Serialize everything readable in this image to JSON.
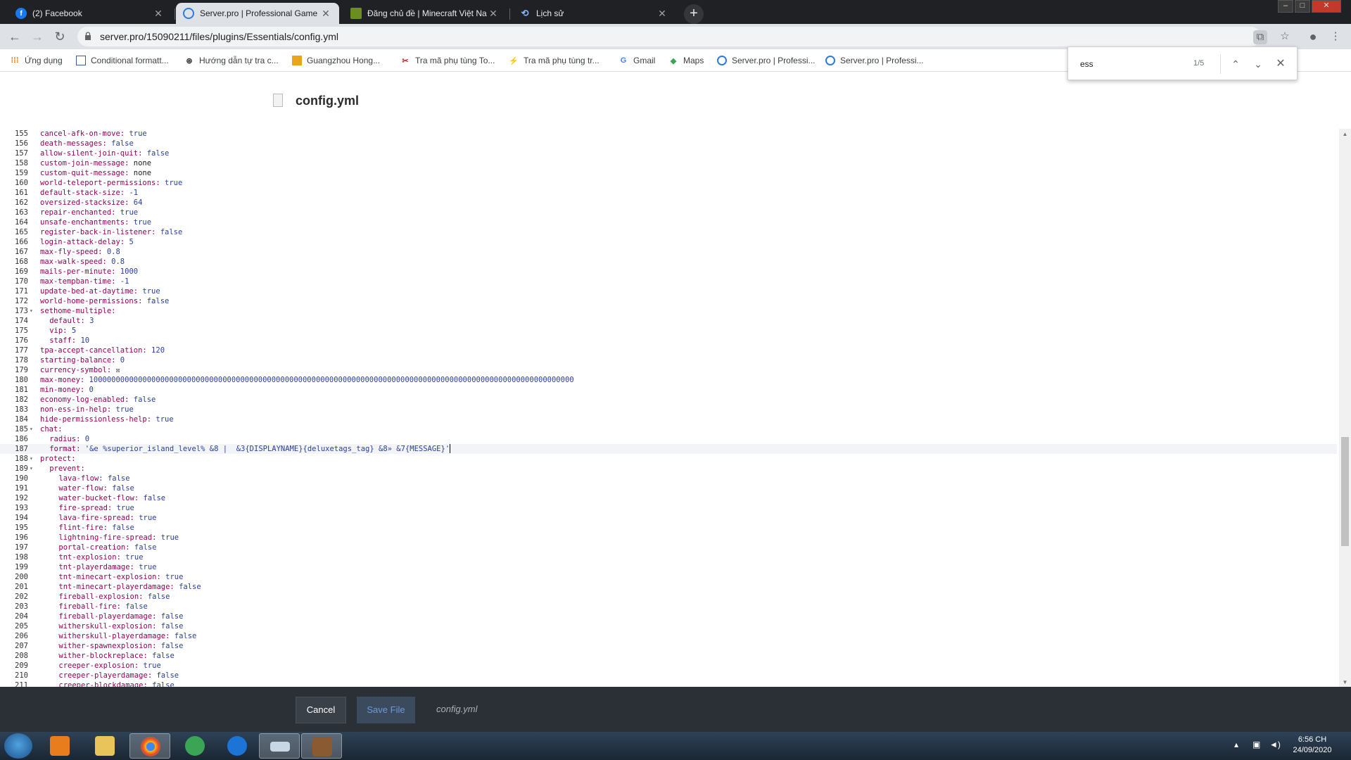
{
  "browser": {
    "tabs": [
      {
        "title": "(2) Facebook",
        "icon": "facebook-icon",
        "active": false
      },
      {
        "title": "Server.pro | Professional Game S",
        "icon": "serverpro-icon",
        "active": true
      },
      {
        "title": "Đăng chủ đề | Minecraft Việt Nan",
        "icon": "minecraft-icon",
        "active": false
      },
      {
        "title": "Lịch sử",
        "icon": "history-icon",
        "active": false
      }
    ],
    "url": "server.pro/15090211/files/plugins/Essentials/config.yml",
    "bookmarks": [
      {
        "label": "Ứng dụng",
        "icon": "apps-grid-icon"
      },
      {
        "label": "Conditional formatt...",
        "icon": "bookmark-doc-icon"
      },
      {
        "label": "Hướng dẫn tự tra c...",
        "icon": "bookmark-wheel-icon"
      },
      {
        "label": "Guangzhou Hong...",
        "icon": "bookmark-flag-icon"
      },
      {
        "label": "Tra mã phụ tùng To...",
        "icon": "bookmark-car-icon"
      },
      {
        "label": "Tra mã phụ tùng tr...",
        "icon": "bookmark-part-icon"
      },
      {
        "label": "Gmail",
        "icon": "google-icon"
      },
      {
        "label": "Maps",
        "icon": "maps-icon"
      },
      {
        "label": "Server.pro | Professi...",
        "icon": "serverpro-icon"
      },
      {
        "label": "Server.pro | Professi...",
        "icon": "serverpro-icon"
      }
    ]
  },
  "find": {
    "query": "ess",
    "count": "1/5"
  },
  "page": {
    "title": "config.yml"
  },
  "editor": {
    "lines": [
      {
        "n": "155",
        "indent": 0,
        "key": "cancel-afk-on-move:",
        "val": "true",
        "vt": "v"
      },
      {
        "n": "156",
        "indent": 0,
        "key": "death-messages:",
        "val": "false",
        "vt": "v"
      },
      {
        "n": "157",
        "indent": 0,
        "key": "allow-silent-join-quit:",
        "val": "false",
        "vt": "v"
      },
      {
        "n": "158",
        "indent": 0,
        "key": "custom-join-message:",
        "val": "none",
        "vt": "n"
      },
      {
        "n": "159",
        "indent": 0,
        "key": "custom-quit-message:",
        "val": "none",
        "vt": "n"
      },
      {
        "n": "160",
        "indent": 0,
        "key": "world-teleport-permissions:",
        "val": "true",
        "vt": "v"
      },
      {
        "n": "161",
        "indent": 0,
        "key": "default-stack-size:",
        "val": "-1",
        "vt": "v"
      },
      {
        "n": "162",
        "indent": 0,
        "key": "oversized-stacksize:",
        "val": "64",
        "vt": "v"
      },
      {
        "n": "163",
        "indent": 0,
        "key": "repair-enchanted:",
        "val": "true",
        "vt": "v"
      },
      {
        "n": "164",
        "indent": 0,
        "key": "unsafe-enchantments:",
        "val": "true",
        "vt": "v"
      },
      {
        "n": "165",
        "indent": 0,
        "key": "register-back-in-listener:",
        "val": "false",
        "vt": "v"
      },
      {
        "n": "166",
        "indent": 0,
        "key": "login-attack-delay:",
        "val": "5",
        "vt": "v"
      },
      {
        "n": "167",
        "indent": 0,
        "key": "max-fly-speed:",
        "val": "0.8",
        "vt": "v"
      },
      {
        "n": "168",
        "indent": 0,
        "key": "max-walk-speed:",
        "val": "0.8",
        "vt": "v"
      },
      {
        "n": "169",
        "indent": 0,
        "key": "mails-per-minute:",
        "val": "1000",
        "vt": "v"
      },
      {
        "n": "170",
        "indent": 0,
        "key": "max-tempban-time:",
        "val": "-1",
        "vt": "v"
      },
      {
        "n": "171",
        "indent": 0,
        "key": "update-bed-at-daytime:",
        "val": "true",
        "vt": "v"
      },
      {
        "n": "172",
        "indent": 0,
        "key": "world-home-permissions:",
        "val": "false",
        "vt": "v"
      },
      {
        "n": "173",
        "indent": 0,
        "key": "sethome-multiple:",
        "val": "",
        "vt": "v",
        "fold": true
      },
      {
        "n": "174",
        "indent": 1,
        "key": "default:",
        "val": "3",
        "vt": "v"
      },
      {
        "n": "175",
        "indent": 1,
        "key": "vip:",
        "val": "5",
        "vt": "v"
      },
      {
        "n": "176",
        "indent": 1,
        "key": "staff:",
        "val": "10",
        "vt": "v"
      },
      {
        "n": "177",
        "indent": 0,
        "key": "tpa-accept-cancellation:",
        "val": "120",
        "vt": "v"
      },
      {
        "n": "178",
        "indent": 0,
        "key": "starting-balance:",
        "val": "0",
        "vt": "v"
      },
      {
        "n": "179",
        "indent": 0,
        "key": "currency-symbol:",
        "val": "☒",
        "vt": "n"
      },
      {
        "n": "180",
        "indent": 0,
        "key": "max-money:",
        "val": "1000000000000000000000000000000000000000000000000000000000000000000000000000000000000000000000000000000000000",
        "vt": "v"
      },
      {
        "n": "181",
        "indent": 0,
        "key": "min-money:",
        "val": "0",
        "vt": "v"
      },
      {
        "n": "182",
        "indent": 0,
        "key": "economy-log-enabled:",
        "val": "false",
        "vt": "v"
      },
      {
        "n": "183",
        "indent": 0,
        "key": "non-ess-in-help:",
        "val": "true",
        "vt": "v"
      },
      {
        "n": "184",
        "indent": 0,
        "key": "hide-permissionless-help:",
        "val": "true",
        "vt": "v"
      },
      {
        "n": "185",
        "indent": 0,
        "key": "chat:",
        "val": "",
        "vt": "v",
        "fold": true
      },
      {
        "n": "186",
        "indent": 1,
        "key": "radius:",
        "val": "0",
        "vt": "v"
      },
      {
        "n": "187",
        "indent": 1,
        "key": "format:",
        "val": "'&e %superior_island_level% &8 |  &3{DISPLAYNAME}{deluxetags_tag} &8» &7{MESSAGE}'",
        "vt": "v",
        "active": true
      },
      {
        "n": "188",
        "indent": 0,
        "key": "protect:",
        "val": "",
        "vt": "v",
        "fold": true
      },
      {
        "n": "189",
        "indent": 1,
        "key": "prevent:",
        "val": "",
        "vt": "v",
        "fold": true
      },
      {
        "n": "190",
        "indent": 2,
        "key": "lava-flow:",
        "val": "false",
        "vt": "v"
      },
      {
        "n": "191",
        "indent": 2,
        "key": "water-flow:",
        "val": "false",
        "vt": "v"
      },
      {
        "n": "192",
        "indent": 2,
        "key": "water-bucket-flow:",
        "val": "false",
        "vt": "v"
      },
      {
        "n": "193",
        "indent": 2,
        "key": "fire-spread:",
        "val": "true",
        "vt": "v"
      },
      {
        "n": "194",
        "indent": 2,
        "key": "lava-fire-spread:",
        "val": "true",
        "vt": "v"
      },
      {
        "n": "195",
        "indent": 2,
        "key": "flint-fire:",
        "val": "false",
        "vt": "v"
      },
      {
        "n": "196",
        "indent": 2,
        "key": "lightning-fire-spread:",
        "val": "true",
        "vt": "v"
      },
      {
        "n": "197",
        "indent": 2,
        "key": "portal-creation:",
        "val": "false",
        "vt": "v"
      },
      {
        "n": "198",
        "indent": 2,
        "key": "tnt-explosion:",
        "val": "true",
        "vt": "v"
      },
      {
        "n": "199",
        "indent": 2,
        "key": "tnt-playerdamage:",
        "val": "true",
        "vt": "v"
      },
      {
        "n": "200",
        "indent": 2,
        "key": "tnt-minecart-explosion:",
        "val": "true",
        "vt": "v"
      },
      {
        "n": "201",
        "indent": 2,
        "key": "tnt-minecart-playerdamage:",
        "val": "false",
        "vt": "v"
      },
      {
        "n": "202",
        "indent": 2,
        "key": "fireball-explosion:",
        "val": "false",
        "vt": "v"
      },
      {
        "n": "203",
        "indent": 2,
        "key": "fireball-fire:",
        "val": "false",
        "vt": "v"
      },
      {
        "n": "204",
        "indent": 2,
        "key": "fireball-playerdamage:",
        "val": "false",
        "vt": "v"
      },
      {
        "n": "205",
        "indent": 2,
        "key": "witherskull-explosion:",
        "val": "false",
        "vt": "v"
      },
      {
        "n": "206",
        "indent": 2,
        "key": "witherskull-playerdamage:",
        "val": "false",
        "vt": "v"
      },
      {
        "n": "207",
        "indent": 2,
        "key": "wither-spawnexplosion:",
        "val": "false",
        "vt": "v"
      },
      {
        "n": "208",
        "indent": 2,
        "key": "wither-blockreplace:",
        "val": "false",
        "vt": "v"
      },
      {
        "n": "209",
        "indent": 2,
        "key": "creeper-explosion:",
        "val": "true",
        "vt": "v"
      },
      {
        "n": "210",
        "indent": 2,
        "key": "creeper-playerdamage:",
        "val": "false",
        "vt": "v"
      },
      {
        "n": "211",
        "indent": 2,
        "key": "creeper-blockdamage:",
        "val": "false",
        "vt": "v"
      }
    ]
  },
  "footer": {
    "cancel_label": "Cancel",
    "save_label": "Save File",
    "filename": "config.yml"
  },
  "taskbar": {
    "time": "6:56 CH",
    "date": "24/09/2020"
  },
  "colors": {
    "key": "#990055",
    "value": "#2a3f9c",
    "footer_bg": "#2b3036",
    "save_text": "#6d9bd6"
  }
}
